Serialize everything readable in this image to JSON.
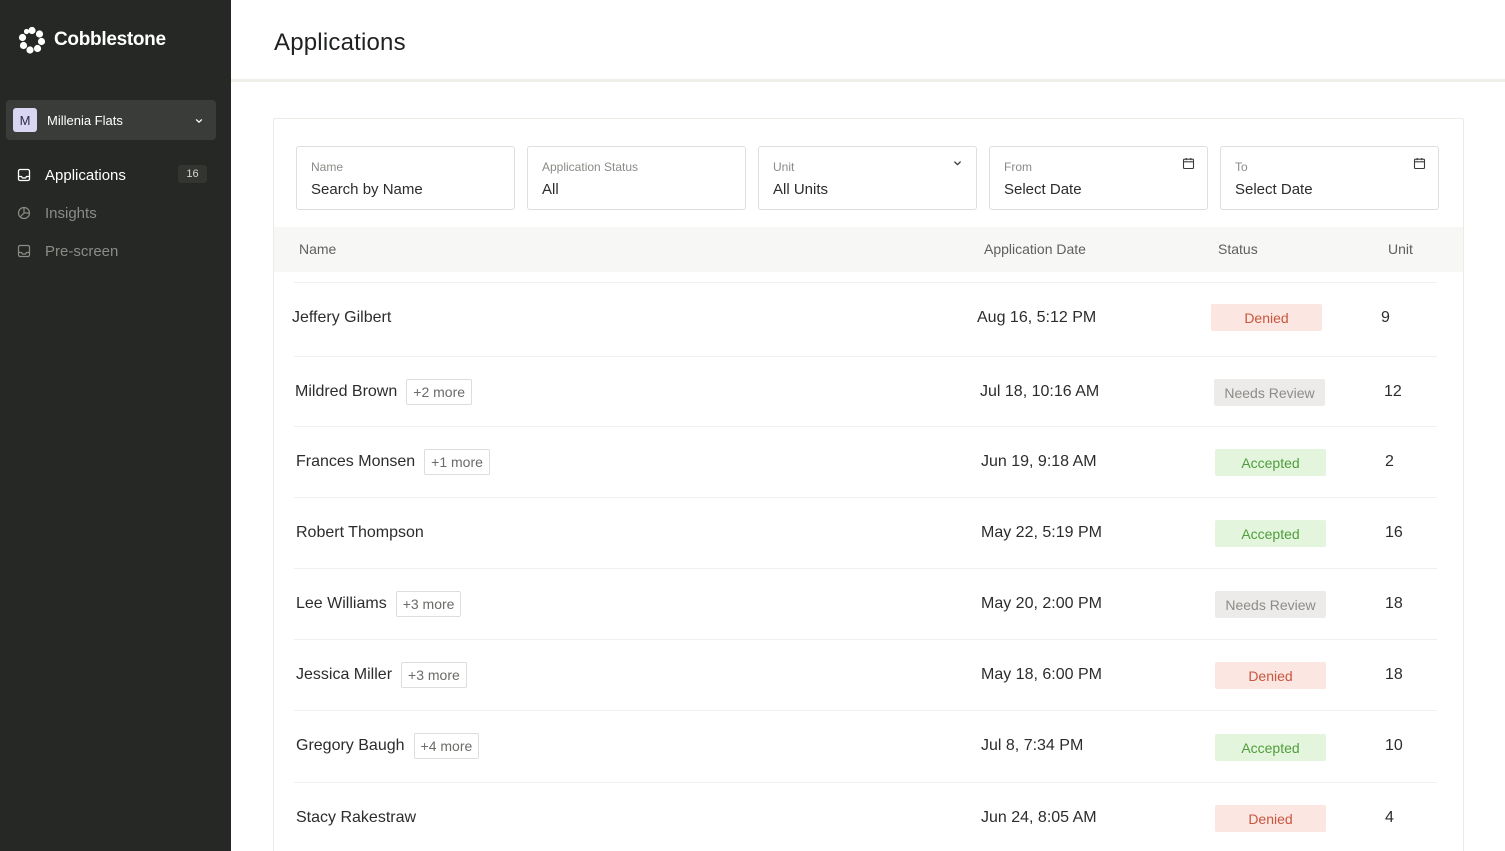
{
  "brand": {
    "name": "Cobblestone",
    "logo_icon": "cobblestone-logo-icon"
  },
  "property_select": {
    "avatar_letter": "M",
    "name": "Millenia Flats",
    "icon": "chevron-down-icon"
  },
  "nav": {
    "items": [
      {
        "label": "Applications",
        "badge": "16",
        "icon": "inbox-icon",
        "active": true
      },
      {
        "label": "Insights",
        "icon": "pie-chart-icon",
        "active": false
      },
      {
        "label": "Pre-screen",
        "icon": "inbox-icon",
        "active": false
      }
    ]
  },
  "page": {
    "title": "Applications"
  },
  "filters": {
    "name": {
      "label": "Name",
      "placeholder": "Search by Name"
    },
    "status": {
      "label": "Application Status",
      "value": "All"
    },
    "unit": {
      "label": "Unit",
      "value": "All Units",
      "icon": "chevron-down-icon"
    },
    "from": {
      "label": "From",
      "placeholder": "Select Date",
      "icon": "calendar-icon"
    },
    "to": {
      "label": "To",
      "placeholder": "Select Date",
      "icon": "calendar-icon"
    }
  },
  "table": {
    "headers": {
      "name": "Name",
      "date": "Application Date",
      "status": "Status",
      "unit": "Unit"
    },
    "rows": [
      {
        "name": "Jeffery Gilbert",
        "more": "",
        "date": "Aug 16, 5:12 PM",
        "status": "Denied",
        "unit": "9"
      },
      {
        "name": "Mildred Brown",
        "more": "+2 more",
        "date": "Jul 18, 10:16 AM",
        "status": "Needs Review",
        "unit": "12"
      },
      {
        "name": "Frances Monsen",
        "more": "+1 more",
        "date": "Jun 19, 9:18 AM",
        "status": "Accepted",
        "unit": "2"
      },
      {
        "name": "Robert Thompson",
        "more": "",
        "date": "May 22, 5:19 PM",
        "status": "Accepted",
        "unit": "16"
      },
      {
        "name": "Lee Williams",
        "more": "+3 more",
        "date": "May 20, 2:00 PM",
        "status": "Needs Review",
        "unit": "18"
      },
      {
        "name": "Jessica Miller",
        "more": "+3 more",
        "date": "May 18, 6:00 PM",
        "status": "Denied",
        "unit": "18"
      },
      {
        "name": "Gregory Baugh",
        "more": "+4 more",
        "date": "Jul 8, 7:34 PM",
        "status": "Accepted",
        "unit": "10"
      },
      {
        "name": "Stacy Rakestraw",
        "more": "",
        "date": "Jun 24, 8:05 AM",
        "status": "Denied",
        "unit": "4"
      }
    ]
  },
  "colors": {
    "sidebar_bg": "#262825",
    "denied_bg": "#fbe6e1",
    "denied_text": "#c8563f",
    "review_bg": "#ecebea",
    "review_text": "#8b8c88",
    "accepted_bg": "#e4f5dd",
    "accepted_text": "#4f9d3c"
  }
}
